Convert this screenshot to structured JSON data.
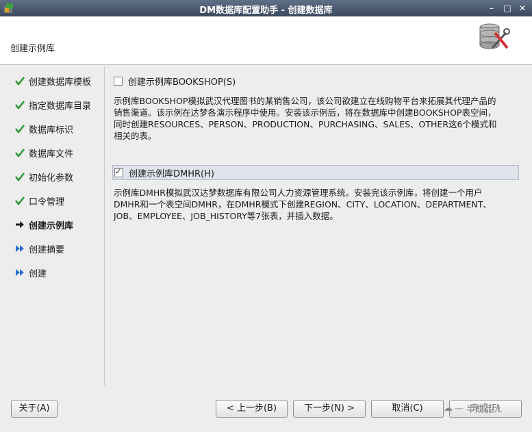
{
  "window": {
    "title": "DM数据库配置助手 - 创建数据库",
    "minimize": "–",
    "maximize": "□",
    "close": "✕"
  },
  "header": {
    "step_title": "创建示例库"
  },
  "sidebar": {
    "items": [
      {
        "label": "创建数据库模板",
        "state": "done"
      },
      {
        "label": "指定数据库目录",
        "state": "done"
      },
      {
        "label": "数据库标识",
        "state": "done"
      },
      {
        "label": "数据库文件",
        "state": "done"
      },
      {
        "label": "初始化参数",
        "state": "done"
      },
      {
        "label": "口令管理",
        "state": "done"
      },
      {
        "label": "创建示例库",
        "state": "current"
      },
      {
        "label": "创建摘要",
        "state": "todo"
      },
      {
        "label": "创建",
        "state": "todo"
      }
    ]
  },
  "content": {
    "bookshop": {
      "label": "创建示例库BOOKSHOP(S)",
      "checked": false,
      "desc": [
        "示例库BOOKSHOP模拟武汉代理图书的某销售公司，该公司欲建立在线购物平台来拓展其代理产品的",
        "销售渠道。该示例在达梦各演示程序中使用。安装该示例后，将在数据库中创建BOOKSHOP表空间，",
        "同时创建RESOURCES、PERSON、PRODUCTION、PURCHASING、SALES、OTHER这6个模式和",
        "相关的表。"
      ]
    },
    "dmhr": {
      "label": "创建示例库DMHR(H)",
      "checked": true,
      "desc": [
        "示例库DMHR模拟武汉达梦数据库有限公司人力资源管理系统。安装完该示例库，将创建一个用户",
        "DMHR和一个表空间DMHR，在DMHR模式下创建REGION、CITY、LOCATION、DEPARTMENT、",
        "JOB、EMPLOYEE、JOB_HISTORY等7张表，并插入数据。"
      ]
    }
  },
  "footer": {
    "about": "关于(A)",
    "prev": "< 上一步(B)",
    "next": "下一步(N) >",
    "cancel": "取消(C)",
    "finish": "完成(F)",
    "watermark": "一 半成品人"
  },
  "colors": {
    "done": "#2e9a2e",
    "current": "#1f1f1f",
    "todo": "#2a6fc9"
  }
}
